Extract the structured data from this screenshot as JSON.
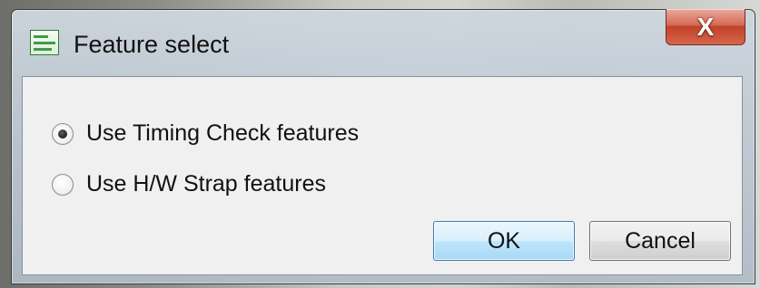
{
  "window": {
    "title": "Feature select",
    "app_icon": "app-icon",
    "close_label": "X"
  },
  "options": [
    {
      "label": "Use Timing Check features",
      "selected": true
    },
    {
      "label": "Use H/W Strap features",
      "selected": false
    }
  ],
  "buttons": {
    "ok_label": "OK",
    "cancel_label": "Cancel"
  }
}
